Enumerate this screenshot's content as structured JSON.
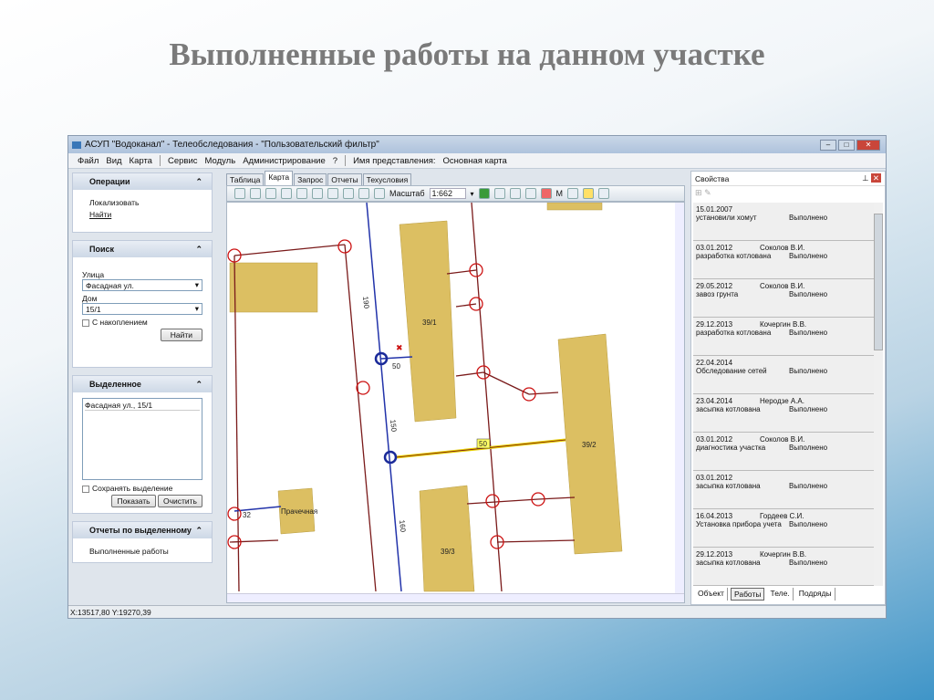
{
  "slide_title": "Выполненные работы на данном участке",
  "window": {
    "title": "АСУП \"Водоканал\" - Телеобследования - \"Пользовательский фильтр\""
  },
  "menu": [
    "Файл",
    "Вид",
    "Карта",
    "Сервис",
    "Модуль",
    "Администрирование",
    "?"
  ],
  "view_label": "Имя представления:",
  "view_name": "Основная карта",
  "left": {
    "operations": {
      "title": "Операции",
      "items": [
        "Локализовать",
        "Найти"
      ]
    },
    "search": {
      "title": "Поиск",
      "street_label": "Улица",
      "street_value": "Фасадная ул.",
      "house_label": "Дом",
      "house_value": "15/1",
      "accumulate": "С накоплением",
      "find": "Найти"
    },
    "selected": {
      "title": "Выделенное",
      "items": [
        "Фасадная ул., 15/1"
      ],
      "save": "Сохранять выделение",
      "show": "Показать",
      "clear": "Очистить"
    },
    "reports": {
      "title": "Отчеты по выделенному",
      "items": [
        "Выполненные работы"
      ]
    }
  },
  "tabs": [
    "Таблица",
    "Карта",
    "Запрос",
    "Отчеты",
    "Техусловия"
  ],
  "toolbar": {
    "scale_label": "Масштаб",
    "scale_value": "1:662",
    "m": "M"
  },
  "map": {
    "labels": {
      "pipe1": "190",
      "pipe2": "150",
      "pipe3": "160",
      "len1": "50",
      "len2": "50",
      "len3": "32",
      "b1": "39/1",
      "b2": "39/2",
      "b3": "39/3",
      "b4": "Прачечная"
    }
  },
  "right": {
    "title": "Свойства",
    "rows": [
      {
        "date": "15.01.2007",
        "person": "",
        "work": "установили хомут",
        "status": "Выполнено"
      },
      {
        "date": "03.01.2012",
        "person": "Соколов В.И.",
        "work": "разработка котлована",
        "status": "Выполнено"
      },
      {
        "date": "29.05.2012",
        "person": "Соколов В.И.",
        "work": "завоз грунта",
        "status": "Выполнено"
      },
      {
        "date": "29.12.2013",
        "person": "Кочергин В.В.",
        "work": "разработка котлована",
        "status": "Выполнено"
      },
      {
        "date": "22.04.2014",
        "person": "",
        "work": "Обследование сетей",
        "status": "Выполнено"
      },
      {
        "date": "23.04.2014",
        "person": "Неродзе А.А.",
        "work": "засыпка котлована",
        "status": "Выполнено"
      },
      {
        "date": "03.01.2012",
        "person": "Соколов В.И.",
        "work": "диагностика участка",
        "status": "Выполнено"
      },
      {
        "date": "03.01.2012",
        "person": "",
        "work": "засыпка котлована",
        "status": "Выполнено"
      },
      {
        "date": "16.04.2013",
        "person": "Гордеев С.И.",
        "work": "Установка прибора учета",
        "status": "Выполнено"
      },
      {
        "date": "29.12.2013",
        "person": "Кочергин В.В.",
        "work": "засыпка котлована",
        "status": "Выполнено"
      }
    ],
    "tabs": [
      "Объект",
      "Работы",
      "Теле.",
      "Подряды"
    ]
  },
  "status": "X:13517,80 Y:19270,39"
}
